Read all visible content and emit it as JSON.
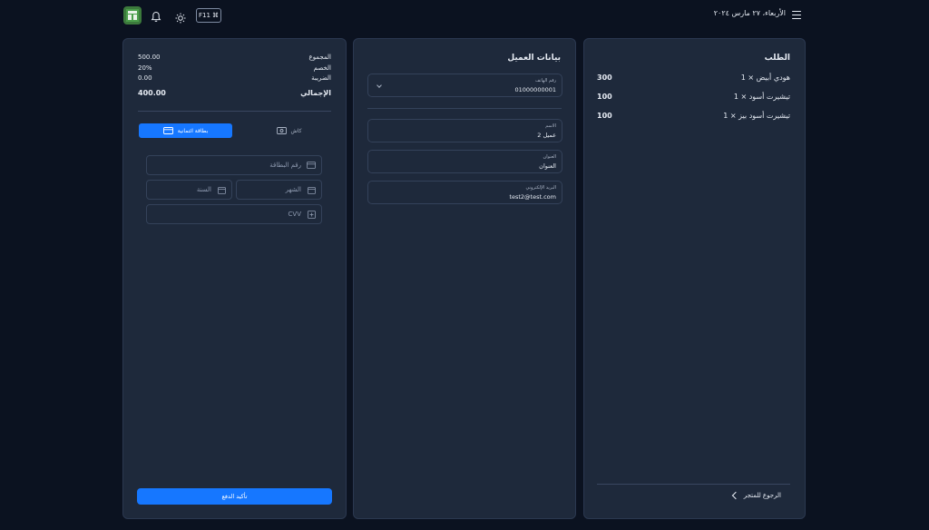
{
  "header": {
    "date": "الأربعاء، ٢٧ مارس ٢٠٢٤",
    "f11_label": "F11",
    "f11_symbol": "⌘"
  },
  "order": {
    "title": "الطلب",
    "items": [
      {
        "name": "هودي أبيض × 1",
        "price": "300"
      },
      {
        "name": "تيشيرت أسود × 1",
        "price": "100"
      },
      {
        "name": "تيشيرت أسود بيز × 1",
        "price": "100"
      }
    ],
    "back_label": "الرجوع للمتجر"
  },
  "customer": {
    "title": "بيانات العميل",
    "phone": {
      "label": "رقم الهاتف",
      "value": "01000000001"
    },
    "name": {
      "label": "الاسم",
      "value": "عميل 2"
    },
    "address": {
      "label": "العنوان",
      "value": "العنوان"
    },
    "email": {
      "label": "البريد الإلكتروني",
      "value": "test2@test.com"
    }
  },
  "payment": {
    "subtotal": {
      "label": "المجموع",
      "value": "500.00"
    },
    "discount": {
      "label": "الخصم",
      "value": "20%"
    },
    "tax": {
      "label": "الضريبة",
      "value": "0.00"
    },
    "total": {
      "label": "الإجمالي",
      "value": "400.00"
    },
    "method_card": "بطاقة ائتمانية",
    "method_cash": "كاش",
    "card_number_placeholder": "رقم البطاقة",
    "month_placeholder": "الشهر",
    "year_placeholder": "السنة",
    "cvv_placeholder": "CVV",
    "confirm_label": "تأكيد الدفع"
  },
  "colors": {
    "background": "#0b1220",
    "panel": "#1e293b",
    "accent": "#1677ff"
  }
}
